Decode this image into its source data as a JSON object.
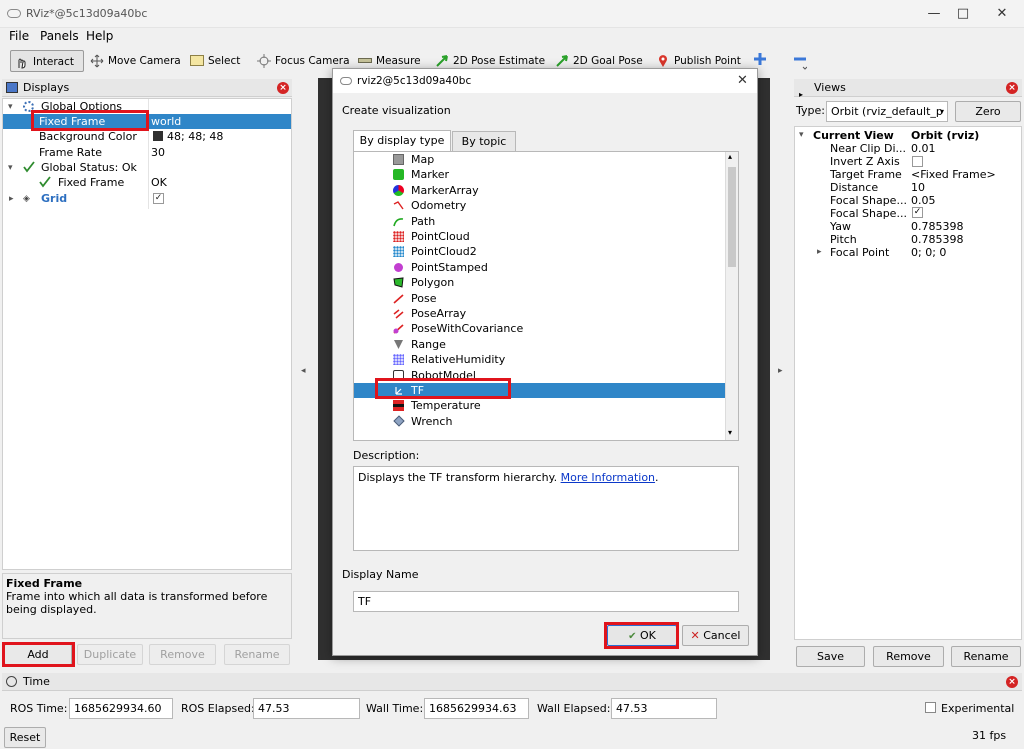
{
  "window": {
    "title": "RViz*@5c13d09a40bc",
    "controls": [
      "—",
      "□",
      "✕"
    ]
  },
  "menu": [
    "File",
    "Panels",
    "Help"
  ],
  "toolbar": {
    "interact": "Interact",
    "move_camera": "Move Camera",
    "select": "Select",
    "focus_camera": "Focus Camera",
    "measure": "Measure",
    "pose_estimate": "2D Pose Estimate",
    "goal_pose": "2D Goal Pose",
    "publish_point": "Publish Point"
  },
  "displays": {
    "title": "Displays",
    "global_options": "Global Options",
    "fixed_frame_label": "Fixed Frame",
    "fixed_frame_value": "world",
    "background_label": "Background Color",
    "background_value": "48; 48; 48",
    "frame_rate_label": "Frame Rate",
    "frame_rate_value": "30",
    "global_status": "Global Status: Ok",
    "status_fixed_frame": "Fixed Frame",
    "status_ok": "OK",
    "grid": "Grid",
    "help_title": "Fixed Frame",
    "help_text": "Frame into which all data is transformed before being displayed.",
    "buttons": {
      "add": "Add",
      "duplicate": "Duplicate",
      "remove": "Remove",
      "rename": "Rename"
    }
  },
  "dialog": {
    "title": "rviz2@5c13d09a40bc",
    "heading": "Create visualization",
    "tabs": [
      "By display type",
      "By topic"
    ],
    "items": [
      "Map",
      "Marker",
      "MarkerArray",
      "Odometry",
      "Path",
      "PointCloud",
      "PointCloud2",
      "PointStamped",
      "Polygon",
      "Pose",
      "PoseArray",
      "PoseWithCovariance",
      "Range",
      "RelativeHumidity",
      "RobotModel",
      "TF",
      "Temperature",
      "Wrench"
    ],
    "selected": "TF",
    "description_label": "Description:",
    "description_text": "Displays the TF transform hierarchy.",
    "more_info": "More Information",
    "display_name_label": "Display Name",
    "display_name_value": "TF",
    "ok": "OK",
    "cancel": "Cancel"
  },
  "views": {
    "title": "Views",
    "type_label": "Type:",
    "type_value": "Orbit (rviz_default_p",
    "zero": "Zero",
    "current_view": "Current View",
    "current_view_value": "Orbit (rviz)",
    "props": [
      {
        "name": "Near Clip Di...",
        "value": "0.01"
      },
      {
        "name": "Invert Z Axis",
        "value": ""
      },
      {
        "name": "Target Frame",
        "value": "<Fixed Frame>"
      },
      {
        "name": "Distance",
        "value": "10"
      },
      {
        "name": "Focal Shape...",
        "value": "0.05"
      },
      {
        "name": "Focal Shape...",
        "value": ""
      },
      {
        "name": "Yaw",
        "value": "0.785398"
      },
      {
        "name": "Pitch",
        "value": "0.785398"
      },
      {
        "name": "Focal Point",
        "value": "0; 0; 0"
      }
    ],
    "buttons": {
      "save": "Save",
      "remove": "Remove",
      "rename": "Rename"
    }
  },
  "time": {
    "title": "Time",
    "ros_time_label": "ROS Time:",
    "ros_time": "1685629934.60",
    "ros_elapsed_label": "ROS Elapsed:",
    "ros_elapsed": "47.53",
    "wall_time_label": "Wall Time:",
    "wall_time": "1685629934.63",
    "wall_elapsed_label": "Wall Elapsed:",
    "wall_elapsed": "47.53",
    "experimental": "Experimental",
    "reset": "Reset",
    "fps": "31 fps"
  },
  "colors": {
    "selection": "#2f86c8",
    "highlight": "#e0141c",
    "viewport": "#303030"
  }
}
